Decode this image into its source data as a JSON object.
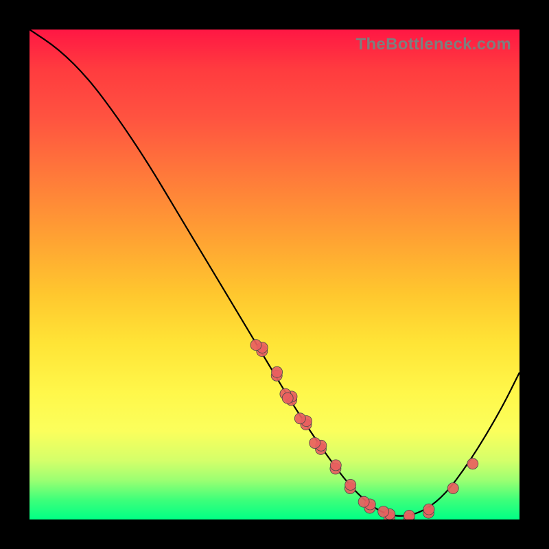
{
  "watermark": "TheBottleneck.com",
  "chart_data": {
    "type": "line",
    "title": "",
    "xlabel": "",
    "ylabel": "",
    "xlim": [
      0,
      100
    ],
    "ylim": [
      0,
      100
    ],
    "curve": [
      {
        "x": 0,
        "y": 100
      },
      {
        "x": 6,
        "y": 96
      },
      {
        "x": 12,
        "y": 90
      },
      {
        "x": 18,
        "y": 82
      },
      {
        "x": 24,
        "y": 73
      },
      {
        "x": 30,
        "y": 63
      },
      {
        "x": 36,
        "y": 53
      },
      {
        "x": 42,
        "y": 43
      },
      {
        "x": 48,
        "y": 33
      },
      {
        "x": 54,
        "y": 23
      },
      {
        "x": 60,
        "y": 14
      },
      {
        "x": 66,
        "y": 6
      },
      {
        "x": 72,
        "y": 1
      },
      {
        "x": 78,
        "y": 0.5
      },
      {
        "x": 84,
        "y": 4
      },
      {
        "x": 90,
        "y": 12
      },
      {
        "x": 96,
        "y": 22
      },
      {
        "x": 100,
        "y": 30
      }
    ],
    "dot_clusters": [
      {
        "x": 47,
        "y": 35,
        "n": 3
      },
      {
        "x": 50,
        "y": 30,
        "n": 2
      },
      {
        "x": 53,
        "y": 25,
        "n": 4
      },
      {
        "x": 56,
        "y": 20,
        "n": 3
      },
      {
        "x": 59,
        "y": 15,
        "n": 3
      },
      {
        "x": 62,
        "y": 11,
        "n": 2
      },
      {
        "x": 65,
        "y": 7,
        "n": 2
      },
      {
        "x": 69,
        "y": 3,
        "n": 3
      },
      {
        "x": 73,
        "y": 1,
        "n": 3
      },
      {
        "x": 77,
        "y": 0.7,
        "n": 2
      },
      {
        "x": 81,
        "y": 2,
        "n": 2
      },
      {
        "x": 86,
        "y": 7,
        "n": 1
      },
      {
        "x": 90,
        "y": 12,
        "n": 1
      }
    ],
    "colors": {
      "curve": "#000000",
      "dot_fill": "#e85f5f",
      "dot_stroke": "#4a4a4a"
    }
  }
}
